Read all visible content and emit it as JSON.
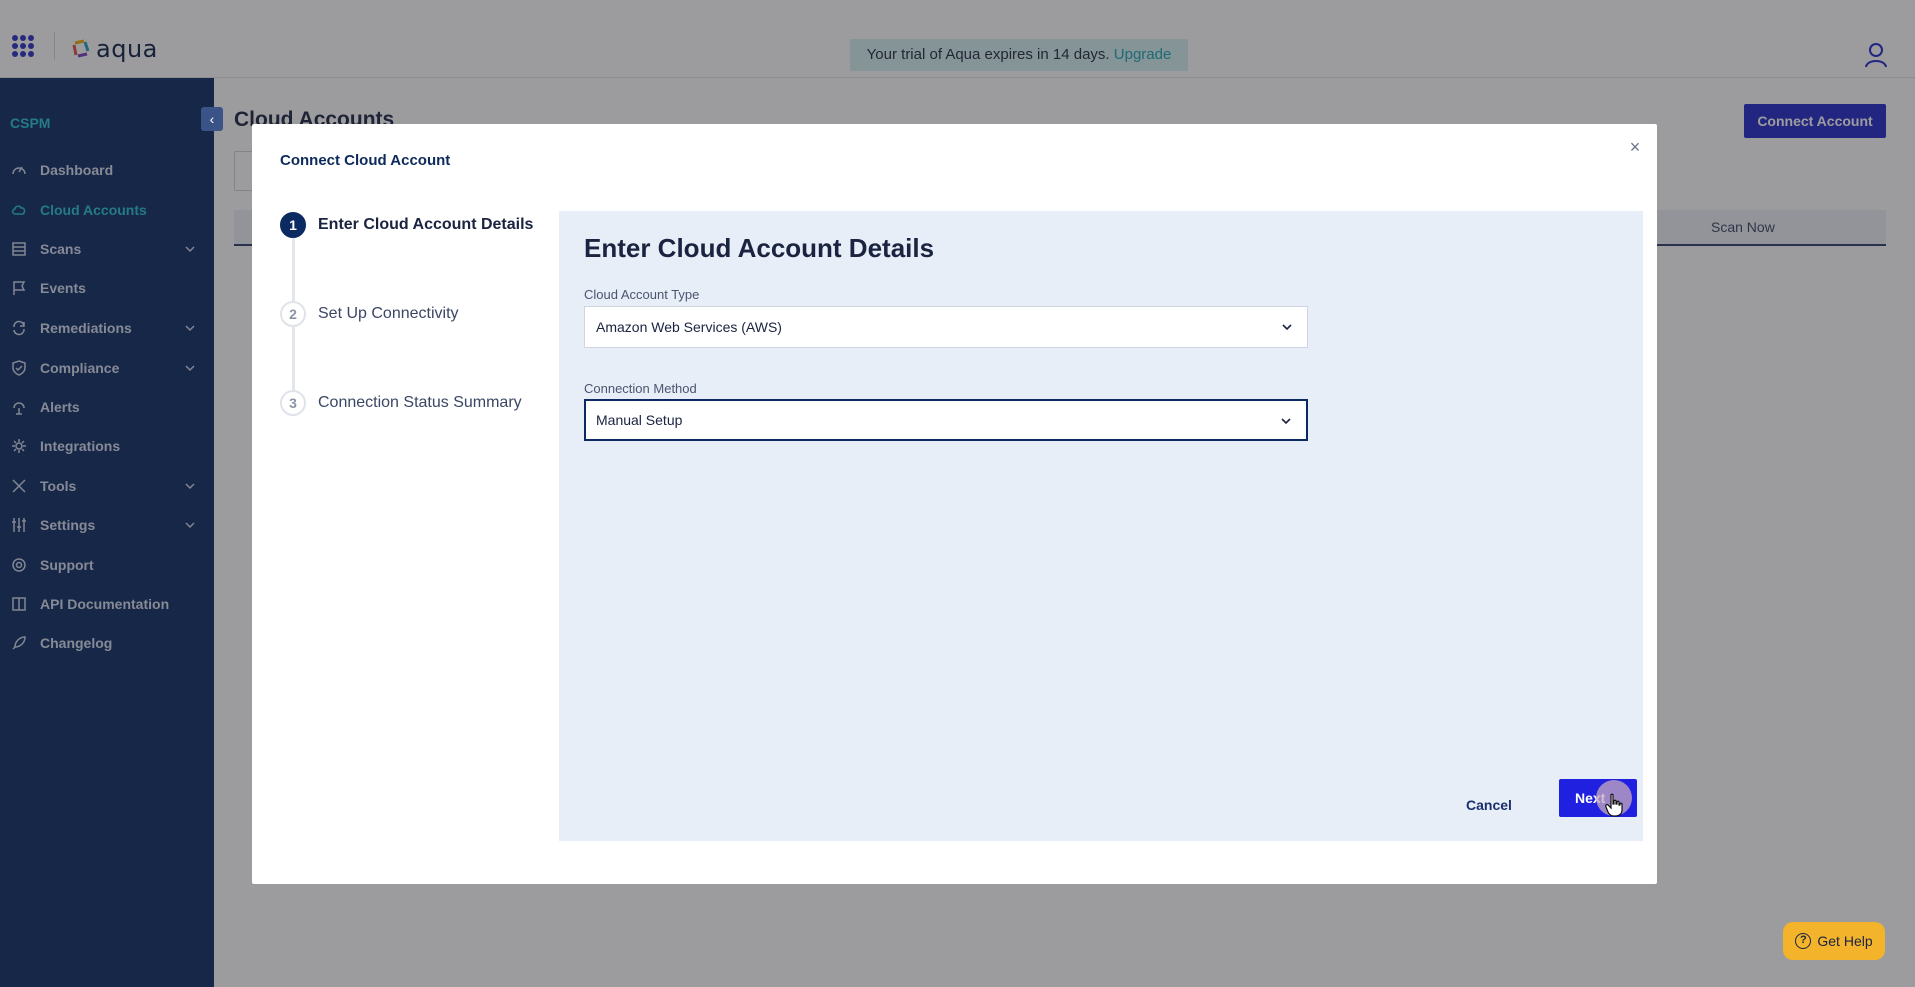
{
  "topbar": {
    "logo_text": "aqua",
    "trial_text": "Your trial of Aqua expires in 14 days.",
    "trial_link": "Upgrade"
  },
  "sidebar": {
    "section": "CSPM",
    "collapse_glyph": "‹",
    "items": [
      {
        "label": "Dashboard",
        "icon": "gauge-icon",
        "expandable": false,
        "active": false
      },
      {
        "label": "Cloud Accounts",
        "icon": "cloud-icon",
        "expandable": false,
        "active": true
      },
      {
        "label": "Scans",
        "icon": "stack-icon",
        "expandable": true,
        "active": false
      },
      {
        "label": "Events",
        "icon": "flag-icon",
        "expandable": false,
        "active": false
      },
      {
        "label": "Remediations",
        "icon": "refresh-icon",
        "expandable": true,
        "active": false
      },
      {
        "label": "Compliance",
        "icon": "shield-check-icon",
        "expandable": true,
        "active": false
      },
      {
        "label": "Alerts",
        "icon": "antenna-icon",
        "expandable": false,
        "active": false
      },
      {
        "label": "Integrations",
        "icon": "gear-icon",
        "expandable": false,
        "active": false
      },
      {
        "label": "Tools",
        "icon": "tools-icon",
        "expandable": true,
        "active": false
      },
      {
        "label": "Settings",
        "icon": "sliders-icon",
        "expandable": true,
        "active": false
      },
      {
        "label": "Support",
        "icon": "lifebuoy-icon",
        "expandable": false,
        "active": false
      },
      {
        "label": "API Documentation",
        "icon": "book-icon",
        "expandable": false,
        "active": false
      },
      {
        "label": "Changelog",
        "icon": "rocket-icon",
        "expandable": false,
        "active": false
      }
    ]
  },
  "page": {
    "title": "Cloud Accounts",
    "connect_button": "Connect Account",
    "scan_now": "Scan Now",
    "get_help": "Get Help"
  },
  "modal": {
    "title": "Connect Cloud Account",
    "close_glyph": "×",
    "steps": [
      {
        "number": "1",
        "label": "Enter Cloud Account Details",
        "active": true
      },
      {
        "number": "2",
        "label": "Set Up Connectivity",
        "active": false
      },
      {
        "number": "3",
        "label": "Connection Status Summary",
        "active": false
      }
    ],
    "form": {
      "heading": "Enter Cloud Account Details",
      "account_type_label": "Cloud Account Type",
      "account_type_value": "Amazon Web Services (AWS)",
      "connection_method_label": "Connection Method",
      "connection_method_value": "Manual Setup"
    },
    "cancel_button": "Cancel",
    "next_button": "Next"
  },
  "colors": {
    "sidebar_bg": "#0b2a62",
    "accent_teal": "#27c2d4",
    "primary_button": "#2428c9",
    "form_panel_bg": "#e8eef7",
    "help_button": "#f3b32a"
  }
}
